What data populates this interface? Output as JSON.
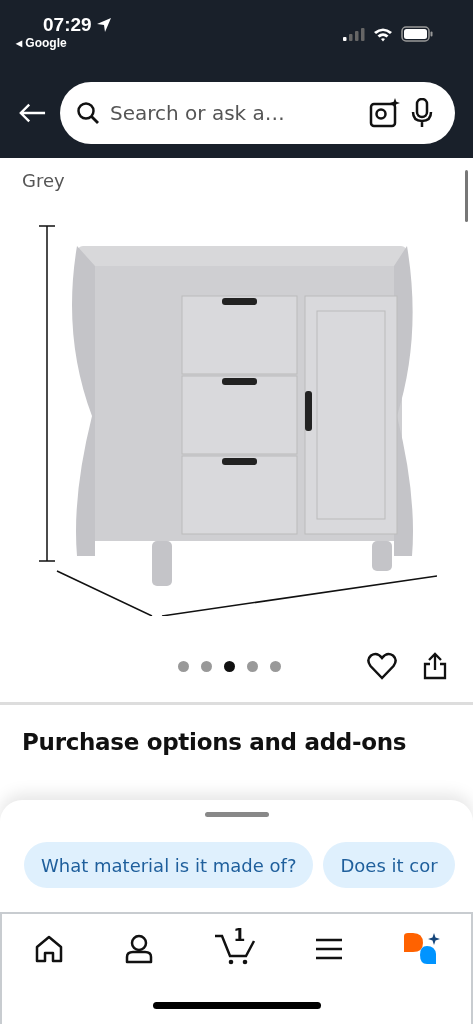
{
  "status_bar": {
    "time": "07:29",
    "back_app": "◂ Google"
  },
  "search": {
    "placeholder": "Search or ask a…"
  },
  "product": {
    "title_tail": "Grey"
  },
  "gallery": {
    "dots": [
      {
        "selected": false
      },
      {
        "selected": false
      },
      {
        "selected": true
      },
      {
        "selected": false
      },
      {
        "selected": false
      }
    ]
  },
  "section_heading": "Purchase options and add-ons",
  "suggestions": [
    "What material is it made of?",
    "Does it cor"
  ],
  "nav": {
    "cart_count": "1"
  }
}
